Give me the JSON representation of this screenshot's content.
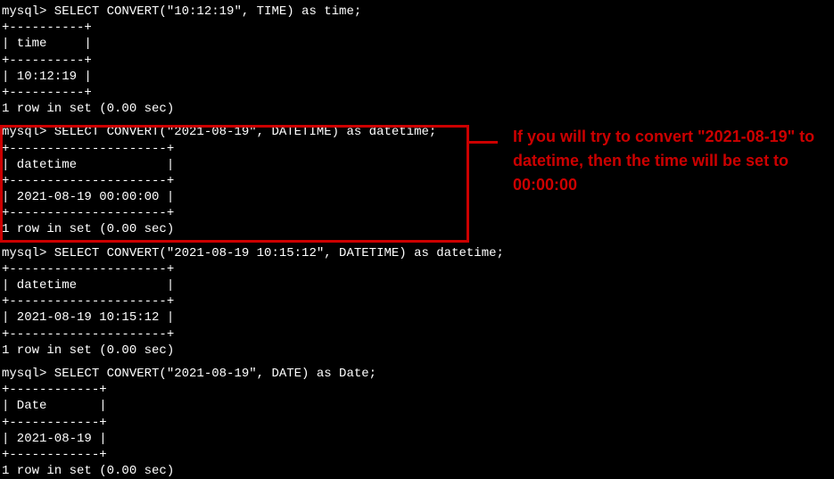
{
  "block1": {
    "prompt": "mysql> SELECT CONVERT(\"10:12:19\", TIME) as time;",
    "sep": "+----------+",
    "header": "| time     |",
    "value": "| 10:12:19 |",
    "footer": "1 row in set (0.00 sec)"
  },
  "block2": {
    "prompt": "mysql> SELECT CONVERT(\"2021-08-19\", DATETIME) as datetime;",
    "sep": "+---------------------+",
    "header": "| datetime            |",
    "value": "| 2021-08-19 00:00:00 |",
    "footer": "1 row in set (0.00 sec)"
  },
  "block3": {
    "prompt": "mysql> SELECT CONVERT(\"2021-08-19 10:15:12\", DATETIME) as datetime;",
    "sep": "+---------------------+",
    "header": "| datetime            |",
    "value": "| 2021-08-19 10:15:12 |",
    "footer": "1 row in set (0.00 sec)"
  },
  "block4": {
    "prompt": "mysql> SELECT CONVERT(\"2021-08-19\", DATE) as Date;",
    "sep": "+------------+",
    "header": "| Date       |",
    "value": "| 2021-08-19 |",
    "footer": "1 row in set (0.00 sec)"
  },
  "annotation": "If you will try to convert \"2021-08-19\" to datetime, then the time will be set to 00:00:00"
}
